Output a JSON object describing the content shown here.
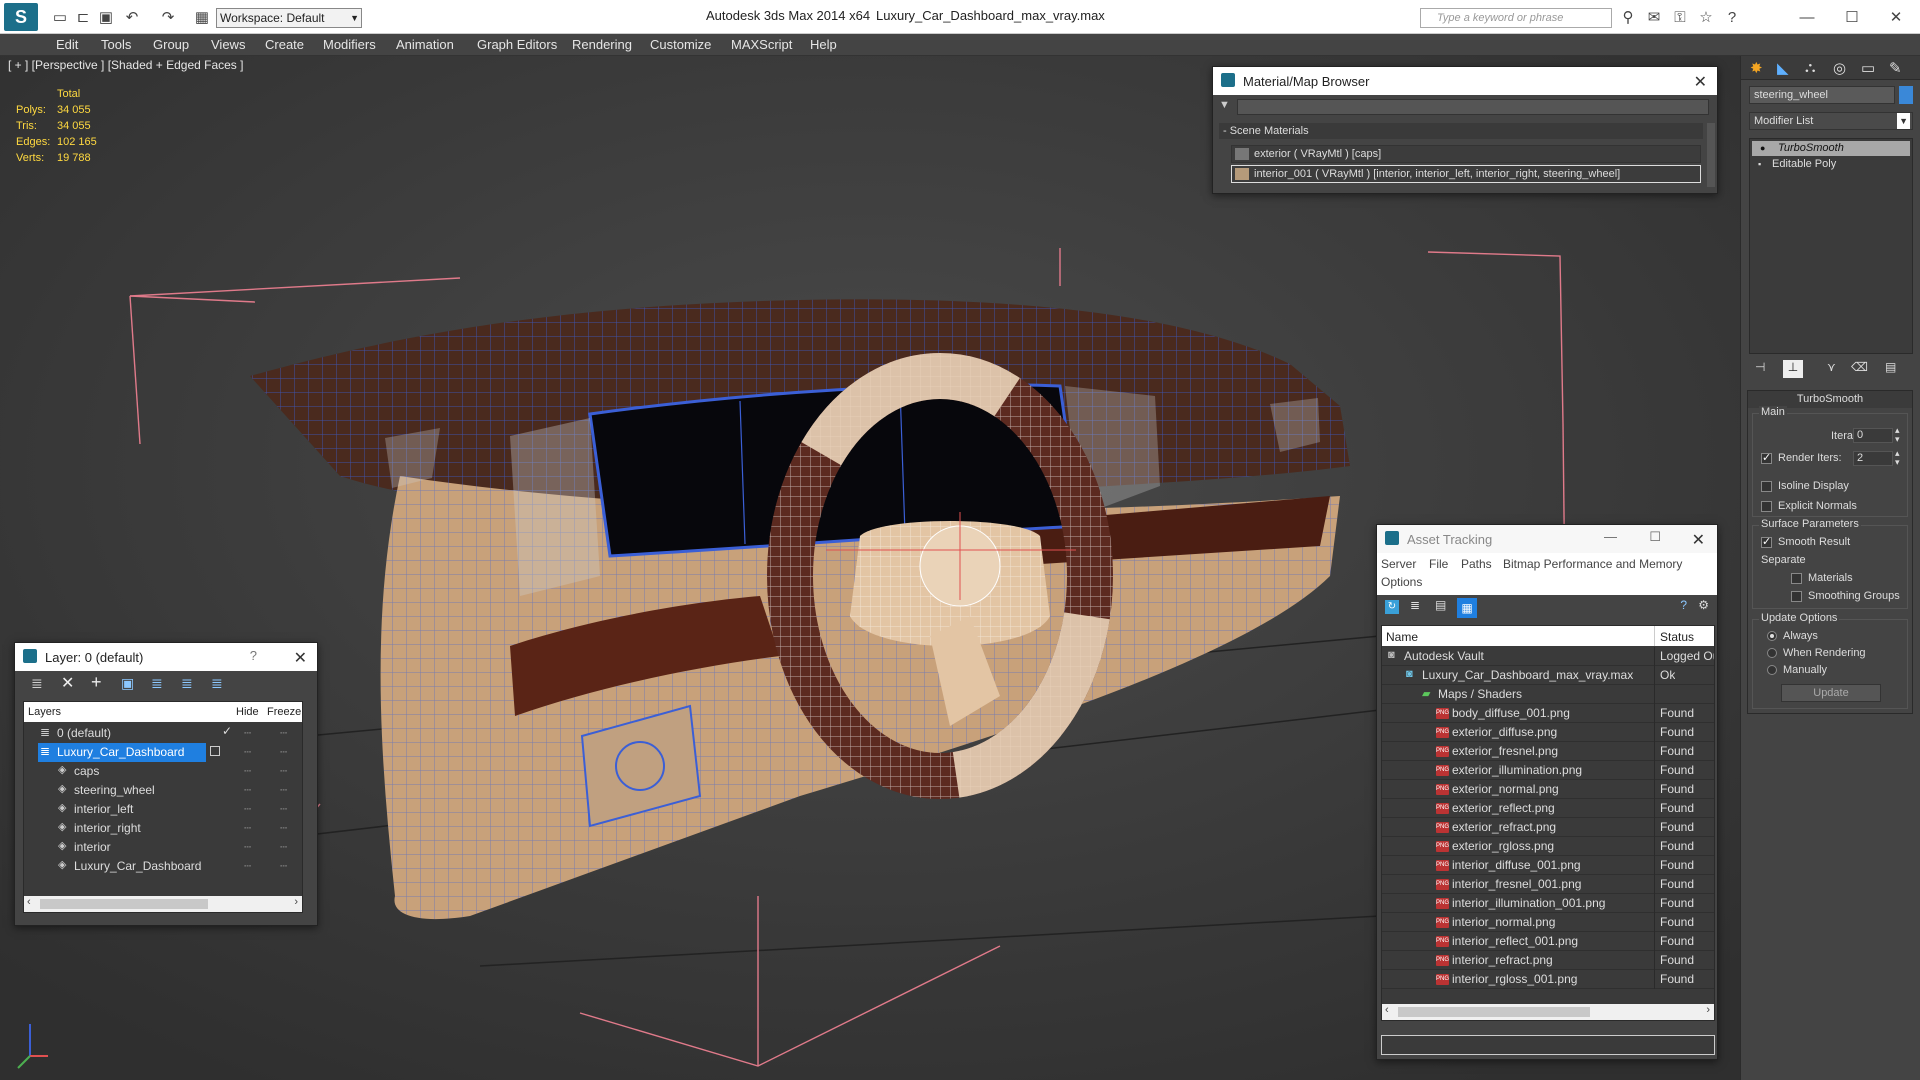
{
  "titlebar": {
    "app": "Autodesk 3ds Max  2014 x64",
    "file": "Luxury_Car_Dashboard_max_vray.max",
    "workspace": "Workspace: Default",
    "search_placeholder": "Type a keyword or phrase"
  },
  "menu": [
    "Edit",
    "Tools",
    "Group",
    "Views",
    "Create",
    "Modifiers",
    "Animation",
    "Graph Editors",
    "Rendering",
    "Customize",
    "MAXScript",
    "Help"
  ],
  "viewport": {
    "label": "[ + ] [Perspective ] [Shaded + Edged Faces ]",
    "stats_header": "Total",
    "stats": [
      {
        "label": "Polys:",
        "value": "34 055"
      },
      {
        "label": "Tris:",
        "value": "34 055"
      },
      {
        "label": "Edges:",
        "value": "102 165"
      },
      {
        "label": "Verts:",
        "value": "19 788"
      }
    ]
  },
  "material_browser": {
    "title": "Material/Map Browser",
    "section": "- Scene Materials",
    "items": [
      "exterior  ( VRayMtl )  [caps]",
      "interior_001  ( VRayMtl )  [interior, interior_left, interior_right, steering_wheel]"
    ]
  },
  "layer_window": {
    "title": "Layer: 0 (default)",
    "help": "?",
    "columns": [
      "Layers",
      "Hide",
      "Freeze"
    ],
    "rows": [
      {
        "name": "0 (default)",
        "level": 0
      },
      {
        "name": "Luxury_Car_Dashboard",
        "level": 0
      },
      {
        "name": "caps",
        "level": 1
      },
      {
        "name": "steering_wheel",
        "level": 1
      },
      {
        "name": "interior_left",
        "level": 1
      },
      {
        "name": "interior_right",
        "level": 1
      },
      {
        "name": "interior",
        "level": 1
      },
      {
        "name": "Luxury_Car_Dashboard",
        "level": 1
      }
    ]
  },
  "asset_tracking": {
    "title": "Asset Tracking",
    "menu": [
      "Server",
      "File",
      "Paths",
      "Bitmap Performance and Memory",
      "Options"
    ],
    "columns": [
      "Name",
      "Status"
    ],
    "rows": [
      {
        "name": "Autodesk Vault",
        "status": "Logged Ou",
        "level": 0
      },
      {
        "name": "Luxury_Car_Dashboard_max_vray.max",
        "status": "Ok",
        "level": 1
      },
      {
        "name": "Maps / Shaders",
        "status": "",
        "level": 2
      },
      {
        "name": "body_diffuse_001.png",
        "status": "Found",
        "level": 3
      },
      {
        "name": "exterior_diffuse.png",
        "status": "Found",
        "level": 3
      },
      {
        "name": "exterior_fresnel.png",
        "status": "Found",
        "level": 3
      },
      {
        "name": "exterior_illumination.png",
        "status": "Found",
        "level": 3
      },
      {
        "name": "exterior_normal.png",
        "status": "Found",
        "level": 3
      },
      {
        "name": "exterior_reflect.png",
        "status": "Found",
        "level": 3
      },
      {
        "name": "exterior_refract.png",
        "status": "Found",
        "level": 3
      },
      {
        "name": "exterior_rgloss.png",
        "status": "Found",
        "level": 3
      },
      {
        "name": "interior_diffuse_001.png",
        "status": "Found",
        "level": 3
      },
      {
        "name": "interior_fresnel_001.png",
        "status": "Found",
        "level": 3
      },
      {
        "name": "interior_illumination_001.png",
        "status": "Found",
        "level": 3
      },
      {
        "name": "interior_normal.png",
        "status": "Found",
        "level": 3
      },
      {
        "name": "interior_reflect_001.png",
        "status": "Found",
        "level": 3
      },
      {
        "name": "interior_refract.png",
        "status": "Found",
        "level": 3
      },
      {
        "name": "interior_rgloss_001.png",
        "status": "Found",
        "level": 3
      }
    ]
  },
  "command_panel": {
    "object_name": "steering_wheel",
    "modifier_list": "Modifier List",
    "stack": [
      "TurboSmooth",
      "Editable Poly"
    ],
    "rollout_title": "TurboSmooth",
    "main_group": "Main",
    "iterations_label": "Iterations:",
    "iterations_value": "0",
    "render_iters_label": "Render Iters:",
    "render_iters_value": "2",
    "isoline": "Isoline Display",
    "explicit_normals": "Explicit Normals",
    "surface_group": "Surface Parameters",
    "smooth_result": "Smooth Result",
    "separate": "Separate",
    "materials": "Materials",
    "smoothing_groups": "Smoothing Groups",
    "update_group": "Update Options",
    "always": "Always",
    "when_rendering": "When Rendering",
    "manually": "Manually",
    "update_button": "Update"
  }
}
